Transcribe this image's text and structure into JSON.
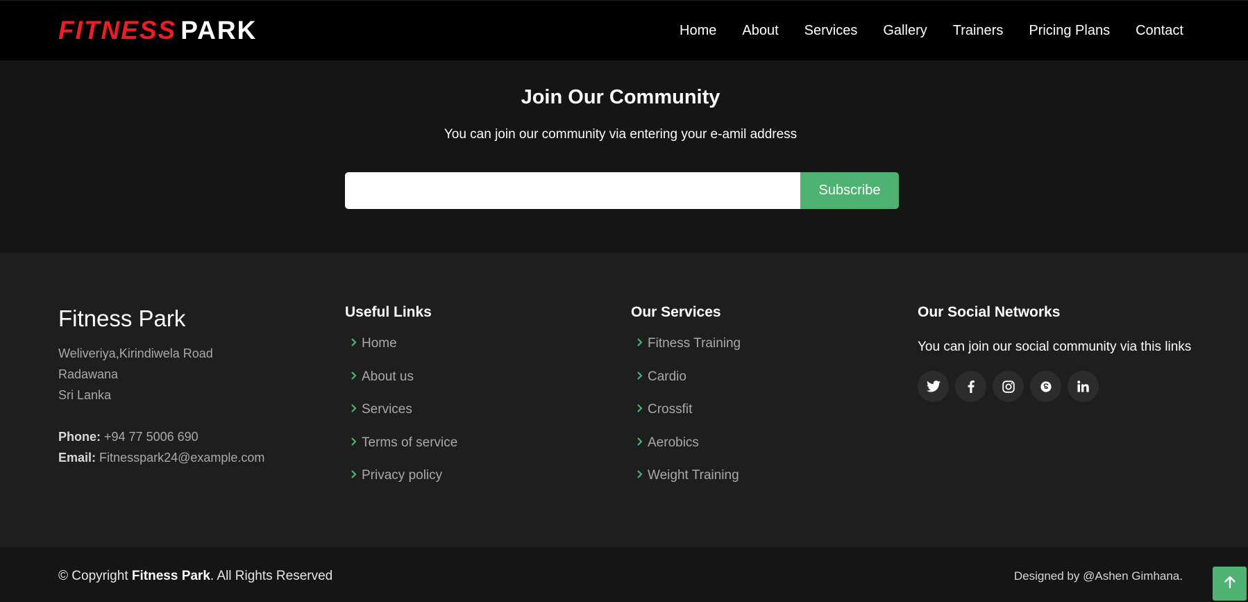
{
  "header": {
    "logo_red": "FITNESS",
    "logo_white": "PARK",
    "nav": [
      "Home",
      "About",
      "Services",
      "Gallery",
      "Trainers",
      "Pricing Plans",
      "Contact"
    ]
  },
  "newsletter": {
    "title": "Join Our Community",
    "subtitle": "You can join our community via entering your e-amil address",
    "input_value": "",
    "button_label": "Subscribe"
  },
  "footer": {
    "brand": {
      "title": "Fitness Park",
      "address": [
        "Weliveriya,Kirindiwela Road",
        "Radawana",
        "Sri Lanka"
      ],
      "phone_label": "Phone:",
      "phone": "+94 77 5006 690",
      "email_label": "Email:",
      "email": "Fitnesspark24@example.com"
    },
    "useful_links": {
      "title": "Useful Links",
      "items": [
        "Home",
        "About us",
        "Services",
        "Terms of service",
        "Privacy policy"
      ]
    },
    "services": {
      "title": "Our Services",
      "items": [
        "Fitness Training",
        "Cardio",
        "Crossfit",
        "Aerobics",
        "Weight Training"
      ]
    },
    "social": {
      "title": "Our Social Networks",
      "text": "You can join our social community via this links",
      "icons": [
        "twitter-icon",
        "facebook-icon",
        "instagram-icon",
        "skype-icon",
        "linkedin-icon"
      ]
    }
  },
  "bottom": {
    "copyright_prefix": "© Copyright",
    "copyright_brand": "Fitness Park",
    "copyright_suffix": ". All Rights Reserved",
    "credits": "Designed by @Ashen Gimhana."
  },
  "colors": {
    "accent_green": "#4db272",
    "logo_red": "#ee1c24",
    "header_bg": "#000000",
    "footer_bg": "#1e1e1e",
    "dark_bg": "#151515"
  }
}
